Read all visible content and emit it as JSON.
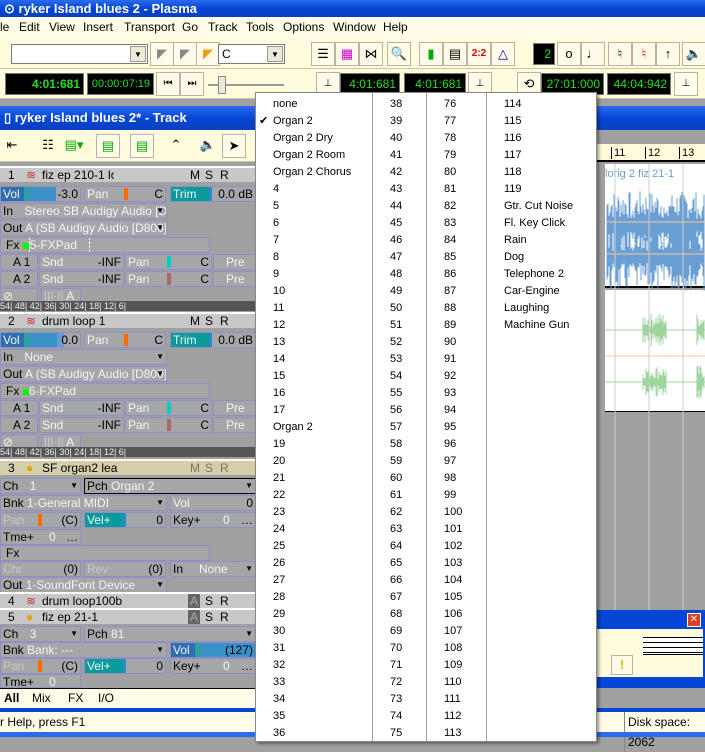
{
  "app": {
    "title": "ryker Island blues 2 - Plasma"
  },
  "menubar": [
    "le",
    "Edit",
    "View",
    "Insert",
    "Transport",
    "Go",
    "Track",
    "Tools",
    "Options",
    "Window",
    "Help"
  ],
  "toolbar1": {
    "combo1_value": "",
    "key_value": "C",
    "lcd_beat": "2"
  },
  "toolbar2": {
    "now_time": "4:01:681",
    "now_smpte": "00:00:07:19",
    "sel_start": "4:01:681",
    "sel_end": "4:01:681",
    "loop_start": "27:01:000",
    "loop_end": "44:04:942"
  },
  "track_window": {
    "title": "ryker Island blues 2* - Track"
  },
  "tracks": [
    {
      "num": "1",
      "name": "fiz ep 210-1 loi",
      "m": "M",
      "s": "S",
      "r": "R",
      "vol_label": "Vol",
      "vol": "-3.0",
      "pan_label": "Pan",
      "pan": "C",
      "trim_label": "Trim",
      "trim": "0.0 dB",
      "in_label": "In",
      "in": "Stereo SB Audigy Audio [D8",
      "out_label": "Out",
      "out": "A (SB Audigy Audio [D800] 3",
      "fx_label": "Fx",
      "fx": "5-FXPad",
      "a1": "A 1",
      "a2": "A 2",
      "snd": "Snd",
      "inf": "-INF",
      "pre": "Pre",
      "auto": "A",
      "meter": "54|  48|  42|  36|  30|  24|  18|  12|    6|"
    },
    {
      "num": "2",
      "name": "drum loop 1",
      "m": "M",
      "s": "S",
      "r": "R",
      "vol_label": "Vol",
      "vol": "0.0",
      "pan_label": "Pan",
      "pan": "C",
      "trim_label": "Trim",
      "trim": "0.0 dB",
      "in_label": "In",
      "in": "None",
      "out_label": "Out",
      "out": "A (SB Audigy Audio [D800] 3",
      "fx_label": "Fx",
      "fx": "6-FXPad",
      "a1": "A 1",
      "a2": "A 2",
      "snd": "Snd",
      "inf": "-INF",
      "pre": "Pre",
      "auto": "A",
      "meter": "54|  48|  42|  36|  30|  24|  18|  12|    6|"
    },
    {
      "num": "3",
      "name": "SF organ2 lea",
      "m": "M",
      "s": "S",
      "r": "R",
      "ch_label": "Ch",
      "ch": "1",
      "pch_label": "Pch",
      "pch": "Organ 2",
      "bnk_label": "Bnk",
      "bnk": "1-General MIDI",
      "vol_label": "Vol",
      "vol": "0",
      "pan_label": "Pan",
      "pan": "(C)",
      "velp_label": "Vel+",
      "velp": "0",
      "keyp_label": "Key+",
      "keyp": "0",
      "tme_label": "Tme+",
      "tme": "0",
      "fx_label": "Fx",
      "chr_label": "Chr",
      "chr": "(0)",
      "rev_label": "Rev",
      "rev": "(0)",
      "in_label": "In",
      "in": "None",
      "out_label": "Out",
      "out": "1-SoundFont Device"
    },
    {
      "num": "4",
      "name": "drum loop100b",
      "m": "A",
      "s": "S",
      "r": "R"
    },
    {
      "num": "5",
      "name": "fiz ep 21-1",
      "m": "A",
      "s": "S",
      "r": "R",
      "ch_label": "Ch",
      "ch": "3",
      "pch_label": "Pch",
      "pch": "81",
      "bnk_label": "Bnk",
      "bnk": "Bank: ---",
      "vol_label": "Vol",
      "vol": "(127)",
      "pan_label": "Pan",
      "pan": "(C)",
      "velp_label": "Vel+",
      "velp": "0",
      "keyp_label": "Key+",
      "keyp": "0",
      "tme_label": "Tme+",
      "tme": "0"
    }
  ],
  "ruler": [
    "11",
    "12",
    "13"
  ],
  "clip_label": "lorig 2 fiz 21-1",
  "tabs": [
    "All",
    "Mix",
    "FX",
    "I/O"
  ],
  "status": {
    "help": "r Help, press F1",
    "disk": "Disk space: 2062"
  },
  "patch_menu": {
    "selected": "Organ 2",
    "columns": [
      [
        "none",
        "Organ 2",
        "Organ 2 Dry",
        "Organ 2 Room",
        "Organ 2 Chorus",
        "4",
        "5",
        "6",
        "7",
        "8",
        "9",
        "10",
        "11",
        "12",
        "13",
        "14",
        "15",
        "16",
        "17",
        "Organ 2",
        "19",
        "20",
        "21",
        "22",
        "23",
        "24",
        "25",
        "26",
        "27",
        "28",
        "29",
        "30",
        "31",
        "32",
        "33",
        "34",
        "35",
        "36"
      ],
      [
        "38",
        "39",
        "40",
        "41",
        "42",
        "43",
        "44",
        "45",
        "46",
        "47",
        "48",
        "49",
        "50",
        "51",
        "52",
        "53",
        "54",
        "55",
        "56",
        "57",
        "58",
        "59",
        "60",
        "61",
        "62",
        "63",
        "64",
        "65",
        "66",
        "67",
        "68",
        "69",
        "70",
        "71",
        "72",
        "73",
        "74",
        "75"
      ],
      [
        "76",
        "77",
        "78",
        "79",
        "80",
        "81",
        "82",
        "83",
        "84",
        "85",
        "86",
        "87",
        "88",
        "89",
        "90",
        "91",
        "92",
        "93",
        "94",
        "95",
        "96",
        "97",
        "98",
        "99",
        "100",
        "101",
        "102",
        "103",
        "104",
        "105",
        "106",
        "107",
        "108",
        "109",
        "110",
        "111",
        "112",
        "113"
      ],
      [
        "114",
        "115",
        "116",
        "117",
        "118",
        "119",
        "Gtr. Cut Noise",
        "Fl. Key Click",
        "Rain",
        "Dog",
        "Telephone 2",
        "Car-Engine",
        "Laughing",
        "Machine Gun"
      ]
    ]
  },
  "colors": {
    "title_blue": "#0646d6",
    "lcd_green": "#1fe01f",
    "toolbar": "#fffbdc",
    "wave_blue": "#6a9fd4",
    "wave_green": "#9fd49f",
    "vol_blue": "#3a92c8",
    "trim_teal": "#0a9a9a",
    "pan_orange": "#ff6a00"
  }
}
